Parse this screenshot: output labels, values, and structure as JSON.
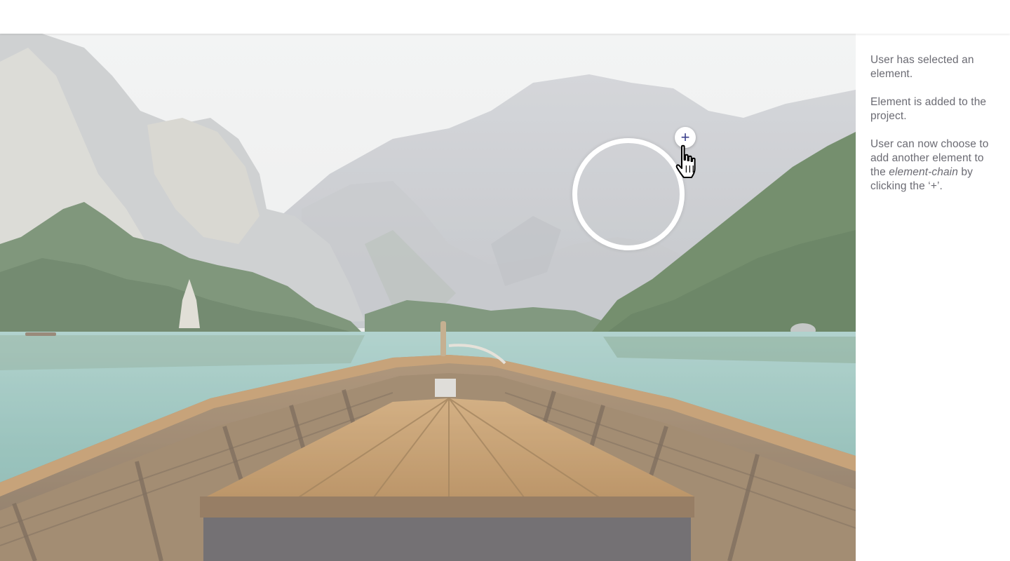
{
  "canvas": {
    "scene": "mountain-lake-boat-photo",
    "add_button_symbol": "+",
    "cursor_icon": "hand-pointer-icon"
  },
  "sidebar": {
    "notes": [
      "User has selected an element.",
      "Element is added to the project.",
      "User can now choose to add another element to the"
    ],
    "note3_italic": "element-chain",
    "note3_tail": " by clicking the ‘+’."
  },
  "colors": {
    "accent": "#3b3f8c",
    "text": "#6b6b73",
    "ring": "#ffffff"
  }
}
